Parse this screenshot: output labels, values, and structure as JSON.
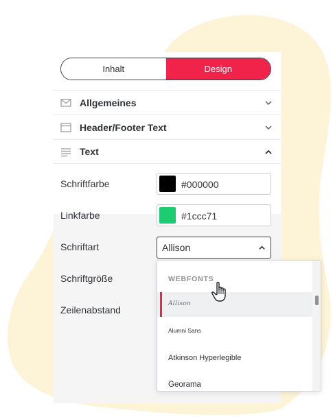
{
  "tabs": {
    "content_label": "Inhalt",
    "design_label": "Design"
  },
  "sections": {
    "general": {
      "label": "Allgemeines"
    },
    "header_footer": {
      "label": "Header/Footer Text"
    },
    "text": {
      "label": "Text"
    }
  },
  "text_settings": {
    "font_color": {
      "label": "Schriftfarbe",
      "value": "#000000",
      "swatch": "#000000"
    },
    "link_color": {
      "label": "Linkfarbe",
      "value": "#1ccc71",
      "swatch": "#1ccc71"
    },
    "font_family": {
      "label": "Schriftart",
      "value": "Allison"
    },
    "font_size": {
      "label": "Schriftgröße"
    },
    "line_height": {
      "label": "Zeilenabstand"
    }
  },
  "dropdown": {
    "group_label": "WEBFONTS",
    "options": [
      "Allison",
      "Alumni Sans",
      "Atkinson Hyperlegible",
      "Georama"
    ],
    "selected": "Allison"
  },
  "colors": {
    "accent": "#f2234b",
    "blob": "#fdf3d7"
  }
}
